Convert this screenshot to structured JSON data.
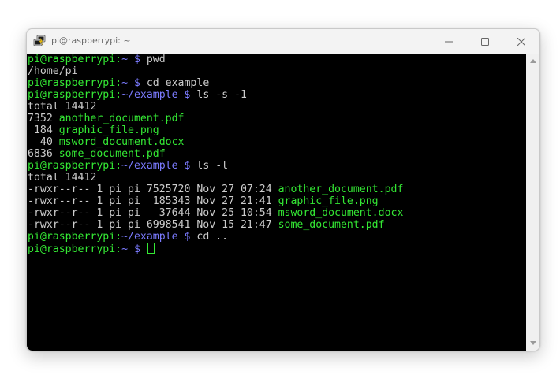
{
  "window": {
    "title": "pi@raspberrypi: ~",
    "app_icon": "putty-icon",
    "controls": [
      "minimize-icon",
      "maximize-icon",
      "close-icon"
    ]
  },
  "colors": {
    "prompt_user": "#34e834",
    "prompt_path": "#7b7bff",
    "text": "#cccccc",
    "background": "#000000"
  },
  "terminal": {
    "lines": [
      {
        "segments": [
          {
            "text": "pi@raspberrypi:",
            "color": "green"
          },
          {
            "text": "~ $ ",
            "color": "blue"
          },
          {
            "text": "pwd",
            "color": "plain"
          }
        ]
      },
      {
        "segments": [
          {
            "text": "/home/pi",
            "color": "plain"
          }
        ]
      },
      {
        "segments": [
          {
            "text": "pi@raspberrypi:",
            "color": "green"
          },
          {
            "text": "~ $ ",
            "color": "blue"
          },
          {
            "text": "cd example",
            "color": "plain"
          }
        ]
      },
      {
        "segments": [
          {
            "text": "pi@raspberrypi:",
            "color": "green"
          },
          {
            "text": "~/example $ ",
            "color": "blue"
          },
          {
            "text": "ls -s -1",
            "color": "plain"
          }
        ]
      },
      {
        "segments": [
          {
            "text": "total 14412",
            "color": "plain"
          }
        ]
      },
      {
        "segments": [
          {
            "text": "7352 ",
            "color": "plain"
          },
          {
            "text": "another_document.pdf",
            "color": "green"
          }
        ]
      },
      {
        "segments": [
          {
            "text": " 184 ",
            "color": "plain"
          },
          {
            "text": "graphic_file.png",
            "color": "green"
          }
        ]
      },
      {
        "segments": [
          {
            "text": "  40 ",
            "color": "plain"
          },
          {
            "text": "msword_document.docx",
            "color": "green"
          }
        ]
      },
      {
        "segments": [
          {
            "text": "6836 ",
            "color": "plain"
          },
          {
            "text": "some_document.pdf",
            "color": "green"
          }
        ]
      },
      {
        "segments": [
          {
            "text": "pi@raspberrypi:",
            "color": "green"
          },
          {
            "text": "~/example $ ",
            "color": "blue"
          },
          {
            "text": "ls -l",
            "color": "plain"
          }
        ]
      },
      {
        "segments": [
          {
            "text": "total 14412",
            "color": "plain"
          }
        ]
      },
      {
        "segments": [
          {
            "text": "-rwxr--r-- 1 pi pi 7525720 Nov 27 07:24 ",
            "color": "plain"
          },
          {
            "text": "another_document.pdf",
            "color": "green"
          }
        ]
      },
      {
        "segments": [
          {
            "text": "-rwxr--r-- 1 pi pi  185343 Nov 27 21:41 ",
            "color": "plain"
          },
          {
            "text": "graphic_file.png",
            "color": "green"
          }
        ]
      },
      {
        "segments": [
          {
            "text": "-rwxr--r-- 1 pi pi   37644 Nov 25 10:54 ",
            "color": "plain"
          },
          {
            "text": "msword_document.docx",
            "color": "green"
          }
        ]
      },
      {
        "segments": [
          {
            "text": "-rwxr--r-- 1 pi pi 6998541 Nov 15 21:47 ",
            "color": "plain"
          },
          {
            "text": "some_document.pdf",
            "color": "green"
          }
        ]
      },
      {
        "segments": [
          {
            "text": "pi@raspberrypi:",
            "color": "green"
          },
          {
            "text": "~/example $ ",
            "color": "blue"
          },
          {
            "text": "cd ..",
            "color": "plain"
          }
        ]
      },
      {
        "segments": [
          {
            "text": "pi@raspberrypi:",
            "color": "green"
          },
          {
            "text": "~ $ ",
            "color": "blue"
          }
        ],
        "cursor": true
      }
    ]
  },
  "scrollbar": {
    "up_icon": "scroll-up-arrow-icon",
    "down_icon": "scroll-down-arrow-icon"
  }
}
